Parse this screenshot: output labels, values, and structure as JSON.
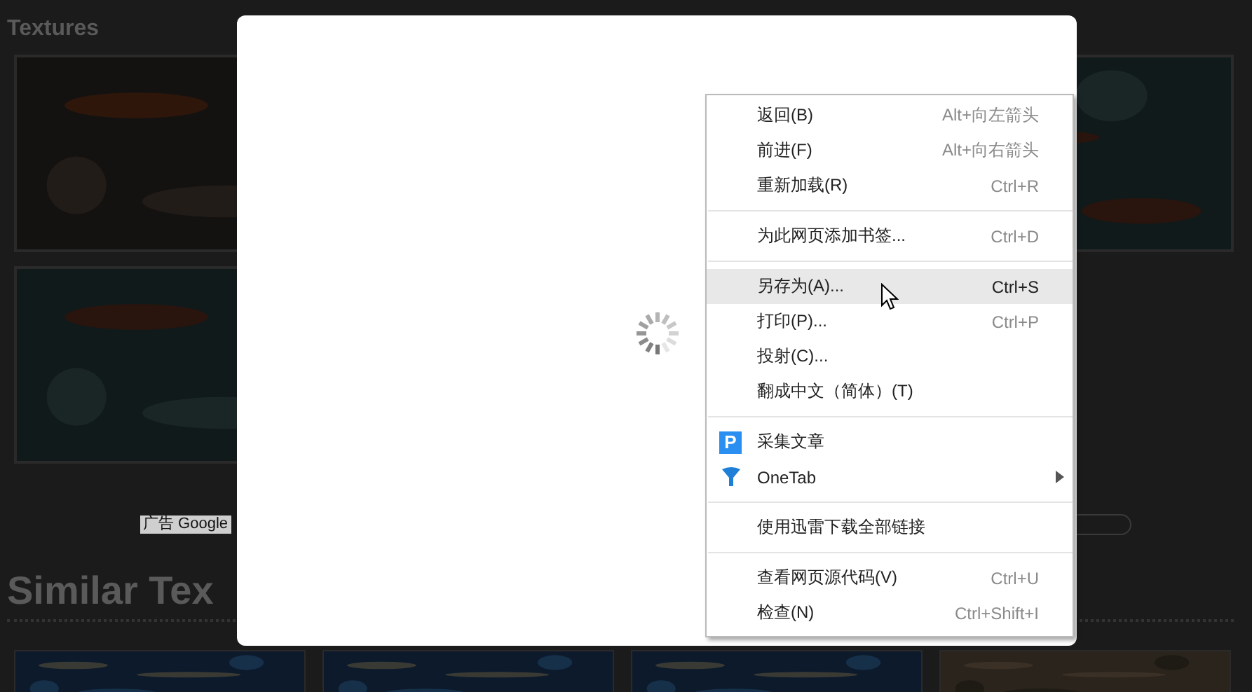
{
  "page": {
    "title": "Textures",
    "ad_label": "广告 Google",
    "section_heading": "Similar Tex"
  },
  "context_menu": {
    "groups": [
      [
        {
          "label": "返回(B)",
          "shortcut": "Alt+向左箭头",
          "selected": false
        },
        {
          "label": "前进(F)",
          "shortcut": "Alt+向右箭头",
          "selected": false
        },
        {
          "label": "重新加载(R)",
          "shortcut": "Ctrl+R",
          "selected": false
        }
      ],
      [
        {
          "label": "为此网页添加书签...",
          "shortcut": "Ctrl+D",
          "selected": false
        }
      ],
      [
        {
          "label": "另存为(A)...",
          "shortcut": "Ctrl+S",
          "selected": true
        },
        {
          "label": "打印(P)...",
          "shortcut": "Ctrl+P",
          "selected": false
        },
        {
          "label": "投射(C)...",
          "selected": false
        },
        {
          "label": "翻成中文（简体）(T)",
          "selected": false
        }
      ],
      [
        {
          "label": "采集文章",
          "kind": "extension",
          "badge": "P",
          "selected": false
        },
        {
          "label": "OneTab",
          "kind": "extension",
          "submenu": true,
          "selected": false
        }
      ],
      [
        {
          "label": "使用迅雷下载全部链接",
          "selected": false
        }
      ],
      [
        {
          "label": "查看网页源代码(V)",
          "shortcut": "Ctrl+U",
          "selected": false
        },
        {
          "label": "检查(N)",
          "shortcut": "Ctrl+Shift+I",
          "selected": false
        }
      ]
    ]
  }
}
